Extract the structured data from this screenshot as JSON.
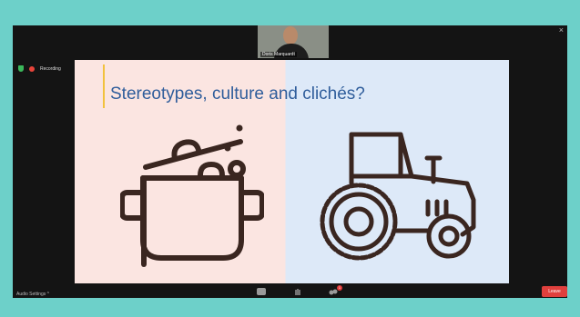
{
  "meeting": {
    "participant_name": "Doris Marquardt",
    "recording_label": "Recording",
    "close_glyph": "×"
  },
  "slide": {
    "title": "Stereotypes, culture and clichés?",
    "left_bg": "#fbe5e1",
    "right_bg": "#dde9f8",
    "title_color": "#2f5d9b",
    "left_icon": "cooking-pot-icon",
    "right_icon": "tractor-icon"
  },
  "controls": {
    "audio_settings_label": "Audio Settings ^",
    "leave_label": "Leave",
    "reactions_badge": "1"
  },
  "colors": {
    "frame": "#6dd0c9",
    "window": "#141414",
    "leave": "#e0403d",
    "recording": "#e8443a",
    "security": "#3cb85b"
  }
}
